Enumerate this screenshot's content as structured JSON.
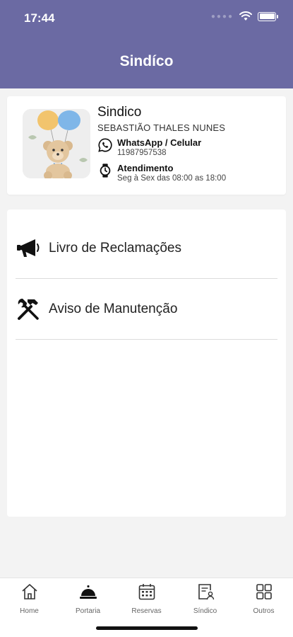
{
  "status_bar": {
    "time": "17:44"
  },
  "header": {
    "title": "Sindíco"
  },
  "sindico": {
    "title": "Sindico",
    "name": "SEBASTIÃO THALES NUNES",
    "whatsapp_label": "WhatsApp / Celular",
    "whatsapp_value": "11987957538",
    "hours_label": "Atendimento",
    "hours_value": "Seg à Sex das 08:00 as 18:00"
  },
  "menu": {
    "items": [
      {
        "label": "Livro de Reclamações",
        "icon": "megaphone-icon"
      },
      {
        "label": "Aviso de Manutenção",
        "icon": "tools-icon"
      }
    ]
  },
  "tabbar": {
    "tabs": [
      {
        "label": "Home",
        "icon": "home-icon"
      },
      {
        "label": "Portaria",
        "icon": "service-bell-icon"
      },
      {
        "label": "Reservas",
        "icon": "calendar-icon"
      },
      {
        "label": "Síndico",
        "icon": "person-document-icon"
      },
      {
        "label": "Outros",
        "icon": "grid-icon"
      }
    ]
  },
  "colors": {
    "header_bg": "#6b6aa3",
    "background": "#f3f3f3",
    "card_bg": "#ffffff"
  }
}
